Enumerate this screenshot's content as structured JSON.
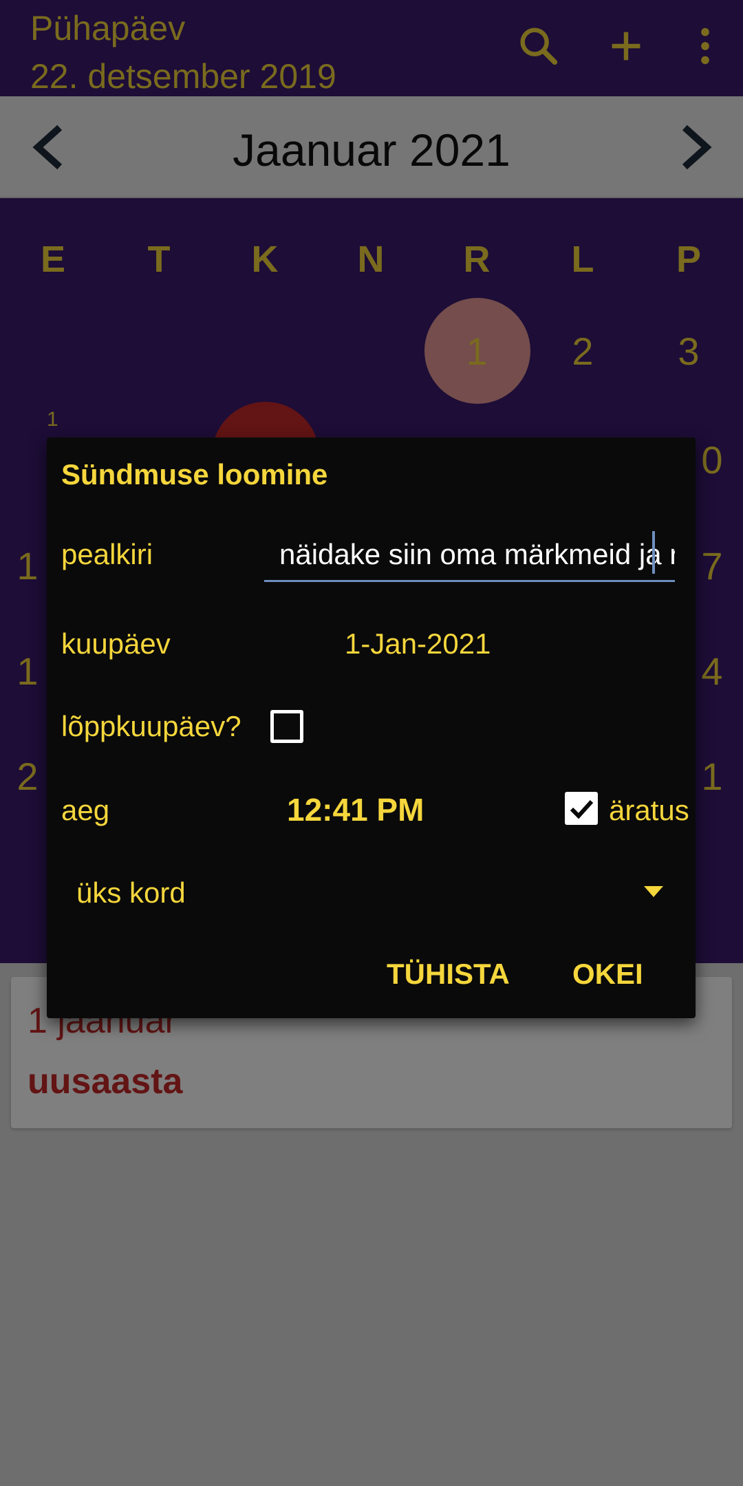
{
  "app_bar": {
    "weekday": "Pühapäev",
    "date": "22. detsember 2019",
    "icons": [
      "search-icon",
      "add-icon",
      "more-vert-icon"
    ]
  },
  "month_nav": {
    "title": "Jaanuar 2021",
    "prev_icon": "chevron-left-icon",
    "next_icon": "chevron-right-icon"
  },
  "calendar": {
    "weekdays": [
      "E",
      "T",
      "K",
      "N",
      "R",
      "L",
      "P"
    ],
    "first_row_days": [
      "1",
      "2",
      "3"
    ],
    "week_number": "1",
    "partial_edge_digits": {
      "left": [
        "1",
        "1",
        "2"
      ],
      "right": [
        "0",
        "7",
        "4",
        "1"
      ]
    }
  },
  "event_card": {
    "date": "1 jaanuar",
    "title": "uusaasta"
  },
  "dialog": {
    "title": "Sündmuse loomine",
    "title_label": "pealkiri",
    "title_value": "näidake siin oma märkmeid ja r",
    "date_label": "kuupäev",
    "date_value": "1-Jan-2021",
    "end_date_label": "lõppkuupäev?",
    "end_date_checked": false,
    "time_label": "aeg",
    "time_value": "12:41 PM",
    "alarm_label": "äratus",
    "alarm_checked": true,
    "repeat_value": "üks kord",
    "cancel_label": "TÜHISTA",
    "ok_label": "OKEI"
  },
  "colors": {
    "accent": "#f5d63c",
    "calendar_bg": "#3b1a6e",
    "dialog_bg": "#0a0a0a",
    "event_red": "#c62828",
    "today_pink": "#e89a98",
    "input_underline": "#6f8fc0"
  }
}
